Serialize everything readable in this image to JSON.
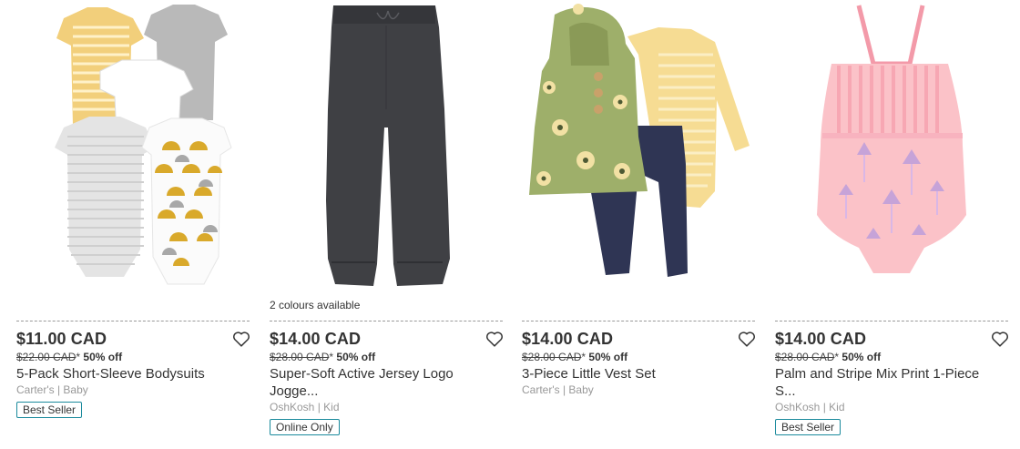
{
  "products": [
    {
      "image": "five-pack-bodysuits-image",
      "colours": "",
      "price": "$11.00 CAD",
      "was_price": "$22.00 CAD",
      "was_separator": "*",
      "discount": "50% off",
      "title_line1": "5-Pack Short-Sleeve Bodysuits",
      "title_line2": "",
      "brand": "Carter's | Baby",
      "badge": "Best Seller"
    },
    {
      "image": "jersey-jogger-image",
      "colours": "2 colours available",
      "price": "$14.00 CAD",
      "was_price": "$28.00 CAD",
      "was_separator": "*",
      "discount": "50% off",
      "title_line1": "Super-Soft Active Jersey Logo",
      "title_line2": "Jogge...",
      "brand": "OshKosh | Kid",
      "badge": "Online Only"
    },
    {
      "image": "vest-set-image",
      "colours": "",
      "price": "$14.00 CAD",
      "was_price": "$28.00 CAD",
      "was_separator": "*",
      "discount": "50% off",
      "title_line1": "3-Piece Little Vest Set",
      "title_line2": "",
      "brand": "Carter's | Baby",
      "badge": ""
    },
    {
      "image": "swimsuit-image",
      "colours": "",
      "price": "$14.00 CAD",
      "was_price": "$28.00 CAD",
      "was_separator": "*",
      "discount": "50% off",
      "title_line1": "Palm and Stripe Mix Print 1-Piece",
      "title_line2": "S...",
      "brand": "OshKosh | Kid",
      "badge": "Best Seller"
    }
  ],
  "icons": {
    "favorite": "heart-outline-icon"
  },
  "colors": {
    "badge_border": "#1a8a9c",
    "text": "#333333",
    "muted": "#999999"
  }
}
